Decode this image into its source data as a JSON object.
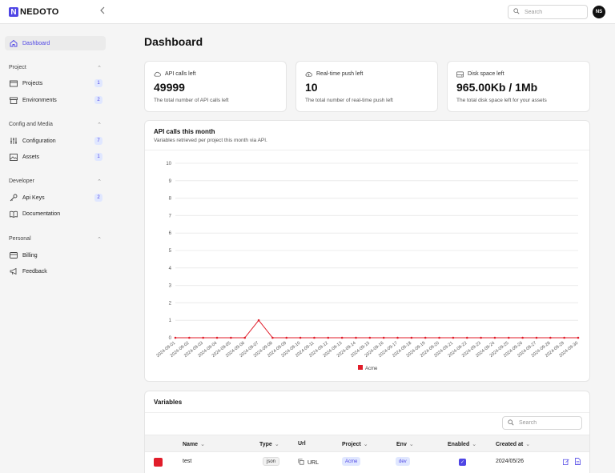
{
  "app": {
    "logo_letter": "N",
    "logo_text": "NEDOTO",
    "user_initials": "NS"
  },
  "header": {
    "search_placeholder": "Search"
  },
  "sidebar": {
    "dashboard": "Dashboard",
    "sections": [
      {
        "title": "Project",
        "items": [
          {
            "label": "Projects",
            "badge": "1"
          },
          {
            "label": "Environments",
            "badge": "2"
          }
        ]
      },
      {
        "title": "Config and Media",
        "items": [
          {
            "label": "Configuration",
            "badge": "7"
          },
          {
            "label": "Assets",
            "badge": "1"
          }
        ]
      },
      {
        "title": "Developer",
        "items": [
          {
            "label": "Api Keys",
            "badge": "2"
          },
          {
            "label": "Documentation",
            "badge": ""
          }
        ]
      },
      {
        "title": "Personal",
        "items": [
          {
            "label": "Billing",
            "badge": ""
          },
          {
            "label": "Feedback",
            "badge": ""
          }
        ]
      }
    ]
  },
  "main": {
    "title": "Dashboard",
    "stats": [
      {
        "label": "API calls left",
        "value": "49999",
        "desc": "The total number of API calls left",
        "icon": "cloud-icon"
      },
      {
        "label": "Real-time push left",
        "value": "10",
        "desc": "The total number of real-time push left",
        "icon": "cloud-upload-icon"
      },
      {
        "label": "Disk space left",
        "value": "965.00Kb / 1Mb",
        "desc": "The total disk space left for your assets",
        "icon": "disk-icon"
      }
    ],
    "chart_card": {
      "title": "API calls this month",
      "subtitle": "Variables retrieved per project this month via API."
    },
    "variables": {
      "title": "Variables",
      "search_placeholder": "Search",
      "columns": {
        "name": "Name",
        "type": "Type",
        "url": "Url",
        "project": "Project",
        "env": "Env",
        "enabled": "Enabled",
        "created": "Created at"
      },
      "rows": [
        {
          "color": "#e11d2a",
          "name": "test",
          "type": "json",
          "url": "URL",
          "project": "Acme",
          "env": "dev",
          "enabled": true,
          "created": "2024/05/26"
        }
      ]
    }
  },
  "chart_data": {
    "type": "line",
    "x": [
      "2024-09-01",
      "2024-09-02",
      "2024-09-03",
      "2024-09-04",
      "2024-09-05",
      "2024-09-06",
      "2024-09-07",
      "2024-09-08",
      "2024-09-09",
      "2024-09-10",
      "2024-09-11",
      "2024-09-12",
      "2024-09-13",
      "2024-09-14",
      "2024-09-15",
      "2024-09-16",
      "2024-09-17",
      "2024-09-18",
      "2024-09-19",
      "2024-09-20",
      "2024-09-21",
      "2024-09-22",
      "2024-09-23",
      "2024-09-24",
      "2024-09-25",
      "2024-09-26",
      "2024-09-27",
      "2024-09-28",
      "2024-09-29",
      "2024-09-30"
    ],
    "series": [
      {
        "name": "Acme",
        "color": "#e11d2a",
        "values": [
          0,
          0,
          0,
          0,
          0,
          0,
          1,
          0,
          0,
          0,
          0,
          0,
          0,
          0,
          0,
          0,
          0,
          0,
          0,
          0,
          0,
          0,
          0,
          0,
          0,
          0,
          0,
          0,
          0,
          0
        ]
      }
    ],
    "ylim": [
      0,
      10
    ],
    "yticks": [
      "0",
      "1",
      "2",
      "3",
      "4",
      "5",
      "6",
      "7",
      "8",
      "9",
      "10"
    ],
    "grid": true,
    "legend": "bottom"
  }
}
